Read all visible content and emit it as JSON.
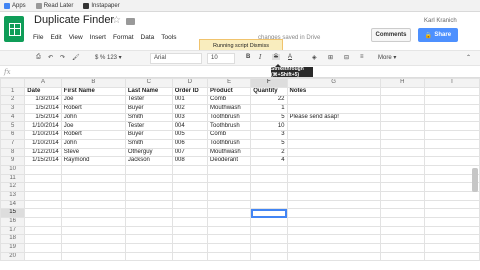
{
  "bookmarks": [
    {
      "label": "Apps",
      "color": "#4285f4"
    },
    {
      "label": "Read Later",
      "color": "#999999"
    },
    {
      "label": "Instapaper",
      "color": "#333333"
    }
  ],
  "header": {
    "title": "Duplicate Finder",
    "user": "Karl Kranich",
    "saved_status": "changes saved in Drive",
    "comments_label": "Comments",
    "share_label": "Share",
    "menu": [
      "File",
      "Edit",
      "View",
      "Insert",
      "Format",
      "Data",
      "Tools"
    ]
  },
  "running_script": "Running script  Dismiss",
  "toolbar": {
    "font_size_format": "$   %   123 ▾",
    "font": "Arial",
    "size": "10",
    "more": "More ▾"
  },
  "tooltip": "Strikethrough (⌘+Shift+5)",
  "fx_label": "fx",
  "columns": [
    "A",
    "B",
    "C",
    "D",
    "E",
    "F",
    "G",
    "H",
    "I"
  ],
  "selected_column": "F",
  "selected_row": 15,
  "rows": [
    [
      "Date",
      "First Name",
      "Last Name",
      "Order ID",
      "Product",
      "Quantity",
      "Notes",
      "",
      ""
    ],
    [
      "1/3/2014",
      "Joe",
      "Tester",
      "001",
      "Comb",
      "22",
      "",
      "",
      ""
    ],
    [
      "1/5/2014",
      "Robert",
      "Buyer",
      "002",
      "Mouthwash",
      "1",
      "",
      "",
      ""
    ],
    [
      "1/5/2014",
      "John",
      "Smith",
      "003",
      "Toothbrush",
      "5",
      "Please send asap!",
      "",
      ""
    ],
    [
      "1/10/2014",
      "Joe",
      "Tester",
      "004",
      "Toothbrush",
      "10",
      "",
      "",
      ""
    ],
    [
      "1/10/2014",
      "Robert",
      "Buyer",
      "005",
      "Comb",
      "3",
      "",
      "",
      ""
    ],
    [
      "1/10/2014",
      "John",
      "Smith",
      "006",
      "Toothbrush",
      "5",
      "",
      "",
      ""
    ],
    [
      "1/12/2014",
      "Steve",
      "Otherguy",
      "007",
      "Mouthwash",
      "2",
      "",
      "",
      ""
    ],
    [
      "1/15/2014",
      "Raymond",
      "Jackson",
      "008",
      "Deoderant",
      "4",
      "",
      "",
      ""
    ],
    [
      "",
      "",
      "",
      "",
      "",
      "",
      "",
      "",
      ""
    ],
    [
      "",
      "",
      "",
      "",
      "",
      "",
      "",
      "",
      ""
    ],
    [
      "",
      "",
      "",
      "",
      "",
      "",
      "",
      "",
      ""
    ],
    [
      "",
      "",
      "",
      "",
      "",
      "",
      "",
      "",
      ""
    ],
    [
      "",
      "",
      "",
      "",
      "",
      "",
      "",
      "",
      ""
    ],
    [
      "",
      "",
      "",
      "",
      "",
      "",
      "",
      "",
      ""
    ],
    [
      "",
      "",
      "",
      "",
      "",
      "",
      "",
      "",
      ""
    ],
    [
      "",
      "",
      "",
      "",
      "",
      "",
      "",
      "",
      ""
    ],
    [
      "",
      "",
      "",
      "",
      "",
      "",
      "",
      "",
      ""
    ],
    [
      "",
      "",
      "",
      "",
      "",
      "",
      "",
      "",
      ""
    ],
    [
      "",
      "",
      "",
      "",
      "",
      "",
      "",
      "",
      ""
    ]
  ]
}
